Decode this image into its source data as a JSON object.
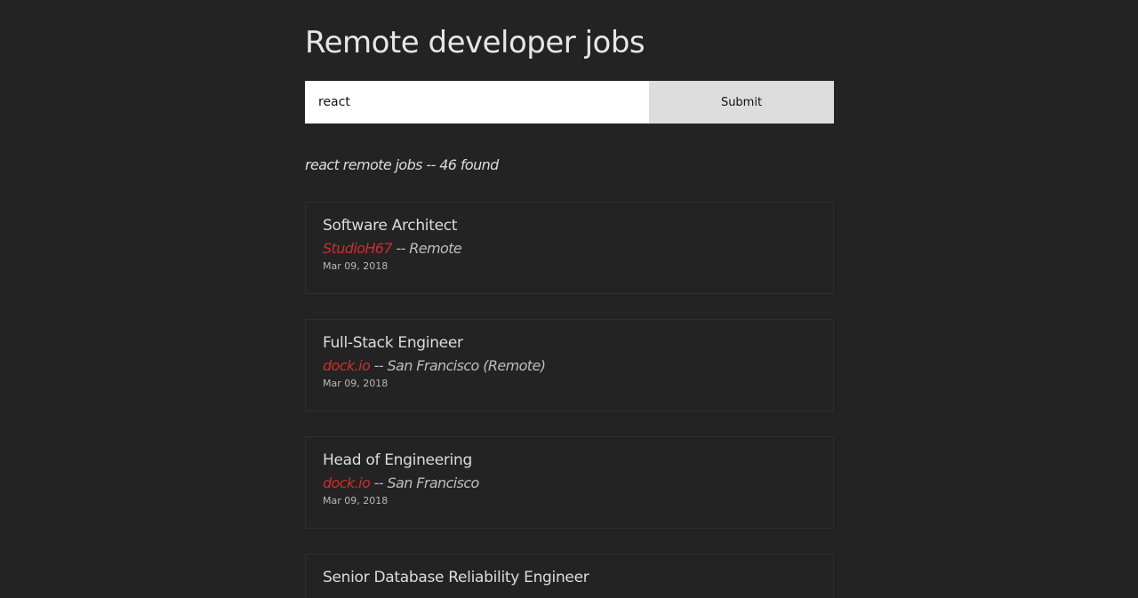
{
  "header": {
    "title": "Remote developer jobs"
  },
  "search": {
    "value": "react",
    "submit_label": "Submit"
  },
  "results": {
    "summary": "react remote jobs -- 46 found"
  },
  "meta_separator": " -- ",
  "jobs": [
    {
      "title": "Software Architect",
      "company": "StudioH67",
      "location": "Remote",
      "date": "Mar 09, 2018"
    },
    {
      "title": "Full-Stack Engineer",
      "company": "dock.io",
      "location": "San Francisco (Remote)",
      "date": "Mar 09, 2018"
    },
    {
      "title": "Head of Engineering",
      "company": "dock.io",
      "location": "San Francisco",
      "date": "Mar 09, 2018"
    },
    {
      "title": "Senior Database Reliability Engineer"
    }
  ],
  "colors": {
    "background": "#232323",
    "company_link": "#c9302c",
    "submit_button": "#dddddd"
  }
}
